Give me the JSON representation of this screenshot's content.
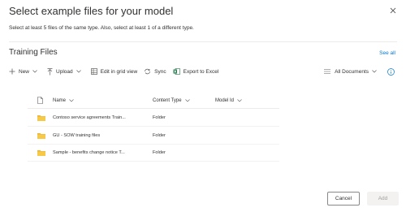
{
  "dialog": {
    "title": "Select example files for your model",
    "subtitle": "Select at least 5 files of the same type. Also, select at least 1 of a different type."
  },
  "library": {
    "title": "Training Files",
    "see_all": "See all"
  },
  "commands": {
    "new": "New",
    "upload": "Upload",
    "edit_grid": "Edit in grid view",
    "sync": "Sync",
    "export": "Export to Excel",
    "view": "All Documents"
  },
  "columns": {
    "name": "Name",
    "content_type": "Content Type",
    "model_id": "Model Id"
  },
  "rows": [
    {
      "name": "Contoso service agreements Train...",
      "content_type": "Folder",
      "model_id": ""
    },
    {
      "name": "GU - SOW training files",
      "content_type": "Folder",
      "model_id": ""
    },
    {
      "name": "Sample - benefits change notice T...",
      "content_type": "Folder",
      "model_id": ""
    }
  ],
  "footer": {
    "cancel": "Cancel",
    "add": "Add"
  },
  "colors": {
    "accent": "#0078d4",
    "folder": "#f0c443",
    "export_icon": "#217346"
  }
}
